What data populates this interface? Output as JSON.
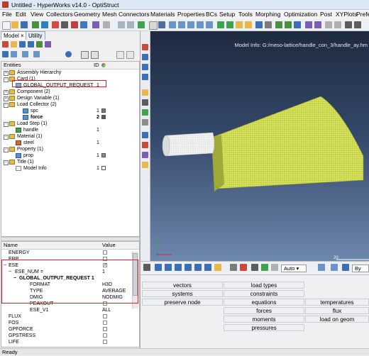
{
  "window": {
    "title": "Untitled - HyperWorks v14.0 - OptiStruct"
  },
  "menu": [
    "File",
    "Edit",
    "View",
    "Collectors",
    "Geometry",
    "Mesh",
    "Connectors",
    "Materials",
    "Properties",
    "BCs",
    "Setup",
    "Tools",
    "Morphing",
    "Optimization",
    "Post",
    "XYPlots",
    "Prefe"
  ],
  "tabs": [
    "Model",
    "Utility"
  ],
  "entities": {
    "headers": {
      "name": "Entities",
      "id": "ID"
    },
    "rows": [
      {
        "label": "Assembly Hierarchy",
        "id": ""
      },
      {
        "label": "Card (1)",
        "id": ""
      },
      {
        "label": "GLOBAL_OUTPUT_REQUEST",
        "id": "1"
      },
      {
        "label": "Component (2)",
        "id": ""
      },
      {
        "label": "Design Variable (1)",
        "id": ""
      },
      {
        "label": "Load Collector (2)",
        "id": ""
      },
      {
        "label": "spc",
        "id": "1"
      },
      {
        "label": "force",
        "id": "2"
      },
      {
        "label": "Load Step (1)",
        "id": ""
      },
      {
        "label": "handle",
        "id": "1"
      },
      {
        "label": "Material (1)",
        "id": ""
      },
      {
        "label": "steel",
        "id": "1"
      },
      {
        "label": "Property (1)",
        "id": ""
      },
      {
        "label": "prop",
        "id": "1"
      },
      {
        "label": "Title (1)",
        "id": ""
      },
      {
        "label": "Model Info",
        "id": "1"
      }
    ]
  },
  "properties": {
    "headers": {
      "name": "Name",
      "value": "Value"
    },
    "rows": [
      {
        "name": "ENERGY",
        "value": ""
      },
      {
        "name": "ERP",
        "value": ""
      },
      {
        "name": "ESE",
        "value": "✓"
      },
      {
        "name": "ESE_NUM =",
        "value": "1"
      },
      {
        "name": "GLOBAL_OUTPUT_REQUEST 1",
        "value": ""
      },
      {
        "name": "FORMAT",
        "value": "H3D"
      },
      {
        "name": "TYPE",
        "value": "AVERAGE"
      },
      {
        "name": "DMIG",
        "value": "NODMIG"
      },
      {
        "name": "PEAKOUT",
        "value": ""
      },
      {
        "name": "ESE_V1",
        "value": "ALL"
      },
      {
        "name": "FLUX",
        "value": ""
      },
      {
        "name": "FOS",
        "value": ""
      },
      {
        "name": "GPFORCE",
        "value": ""
      },
      {
        "name": "GPSTRESS",
        "value": ""
      },
      {
        "name": "LIFE",
        "value": ""
      }
    ]
  },
  "viewport": {
    "model_info": "Model Info: G:/meso-lattice/handle_con_3/handle_ay.hm",
    "scale_label": "20"
  },
  "view_toolbar": {
    "auto_label": "Auto",
    "by_label": "By"
  },
  "panel_menu": {
    "col1": [
      "vectors",
      "systems",
      "preserve node"
    ],
    "col2": [
      "load types",
      "constraints",
      "equations",
      "forces",
      "moments",
      "pressures"
    ],
    "col3": [
      "temperatures",
      "flux",
      "load on geom"
    ]
  },
  "status": "Ready"
}
